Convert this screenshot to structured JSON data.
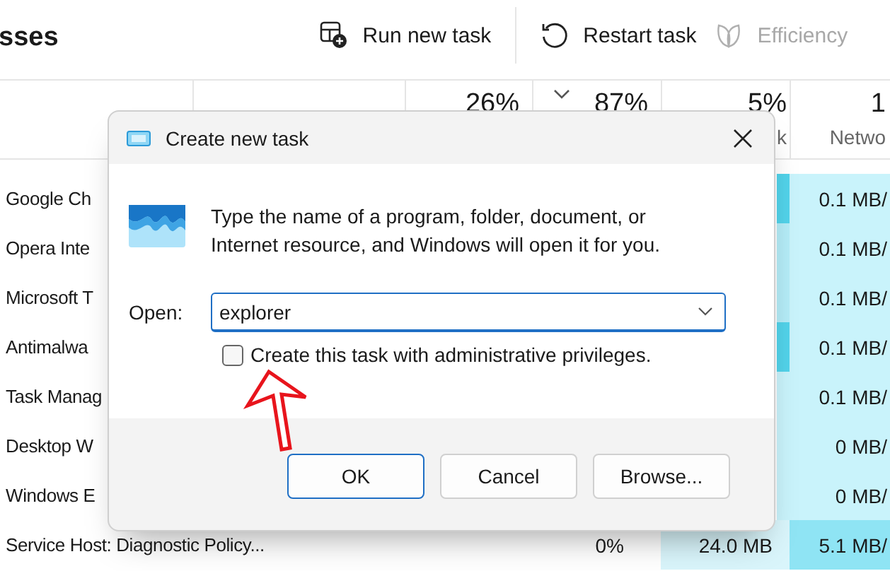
{
  "task_manager": {
    "title": "sses",
    "toolbar": [
      {
        "label": "Run new task",
        "disabled": false
      },
      {
        "label": "Restart task",
        "disabled": false
      },
      {
        "label": "Efficiency",
        "disabled": true
      }
    ],
    "header": [
      {
        "value": "26%"
      },
      {
        "value": "87%",
        "sorted": true
      },
      {
        "value": "5%",
        "label": "k"
      },
      {
        "value": "1",
        "label": "Netwo"
      }
    ],
    "rows": [
      {
        "name": "Google Ch",
        "column_5": {
          "color": "#52d3ea"
        },
        "column_6": {
          "text": "0.1 MB/",
          "color": "#c9f3fb"
        }
      },
      {
        "name": "Opera Inte",
        "column_5": {
          "color": "#b4ecf7"
        },
        "column_6": {
          "text": "0.1 MB/",
          "color": "#c9f3fb"
        }
      },
      {
        "name": "Microsoft T",
        "column_5": {
          "color": "#b4ecf7"
        },
        "column_6": {
          "text": "0.1 MB/",
          "color": "#c9f3fb"
        }
      },
      {
        "name": "Antimalwa",
        "column_5": {
          "color": "#52d3ea"
        },
        "column_6": {
          "text": "0.1 MB/",
          "color": "#c9f3fb"
        }
      },
      {
        "name": "Task Manag",
        "column_5": {
          "color": "#c9f3fb"
        },
        "column_6": {
          "text": "0.1 MB/",
          "color": "#c9f3fb"
        }
      },
      {
        "name": "Desktop W",
        "column_5": {
          "color": "#c9f3fb"
        },
        "column_6": {
          "text": "0 MB/",
          "color": "#c9f3fb"
        }
      },
      {
        "name": "Windows E",
        "column_5": {
          "color": "#c9f3fb"
        },
        "column_6": {
          "text": "0 MB/",
          "color": "#c9f3fb"
        }
      },
      {
        "name": "Service Host: Diagnostic Policy...",
        "column_4": {
          "text": "0%"
        },
        "column_5": {
          "text": "24.0 MB",
          "color": "#d9f5fb"
        },
        "column_6": {
          "text": "5.1 MB/",
          "color": "#8fe4f4"
        }
      }
    ]
  },
  "dialog": {
    "title": "Create new task",
    "message": "Type the name of a program, folder, document, or Internet resource, and Windows will open it for you.",
    "open_label": "Open:",
    "open_value": "explorer",
    "admin_checkbox": {
      "label": "Create this task with administrative privileges.",
      "checked": false
    },
    "buttons": [
      {
        "label": "OK",
        "default": true
      },
      {
        "label": "Cancel",
        "default": false
      },
      {
        "label": "Browse...",
        "default": false
      }
    ]
  },
  "annotation": {
    "kind": "arrow"
  }
}
